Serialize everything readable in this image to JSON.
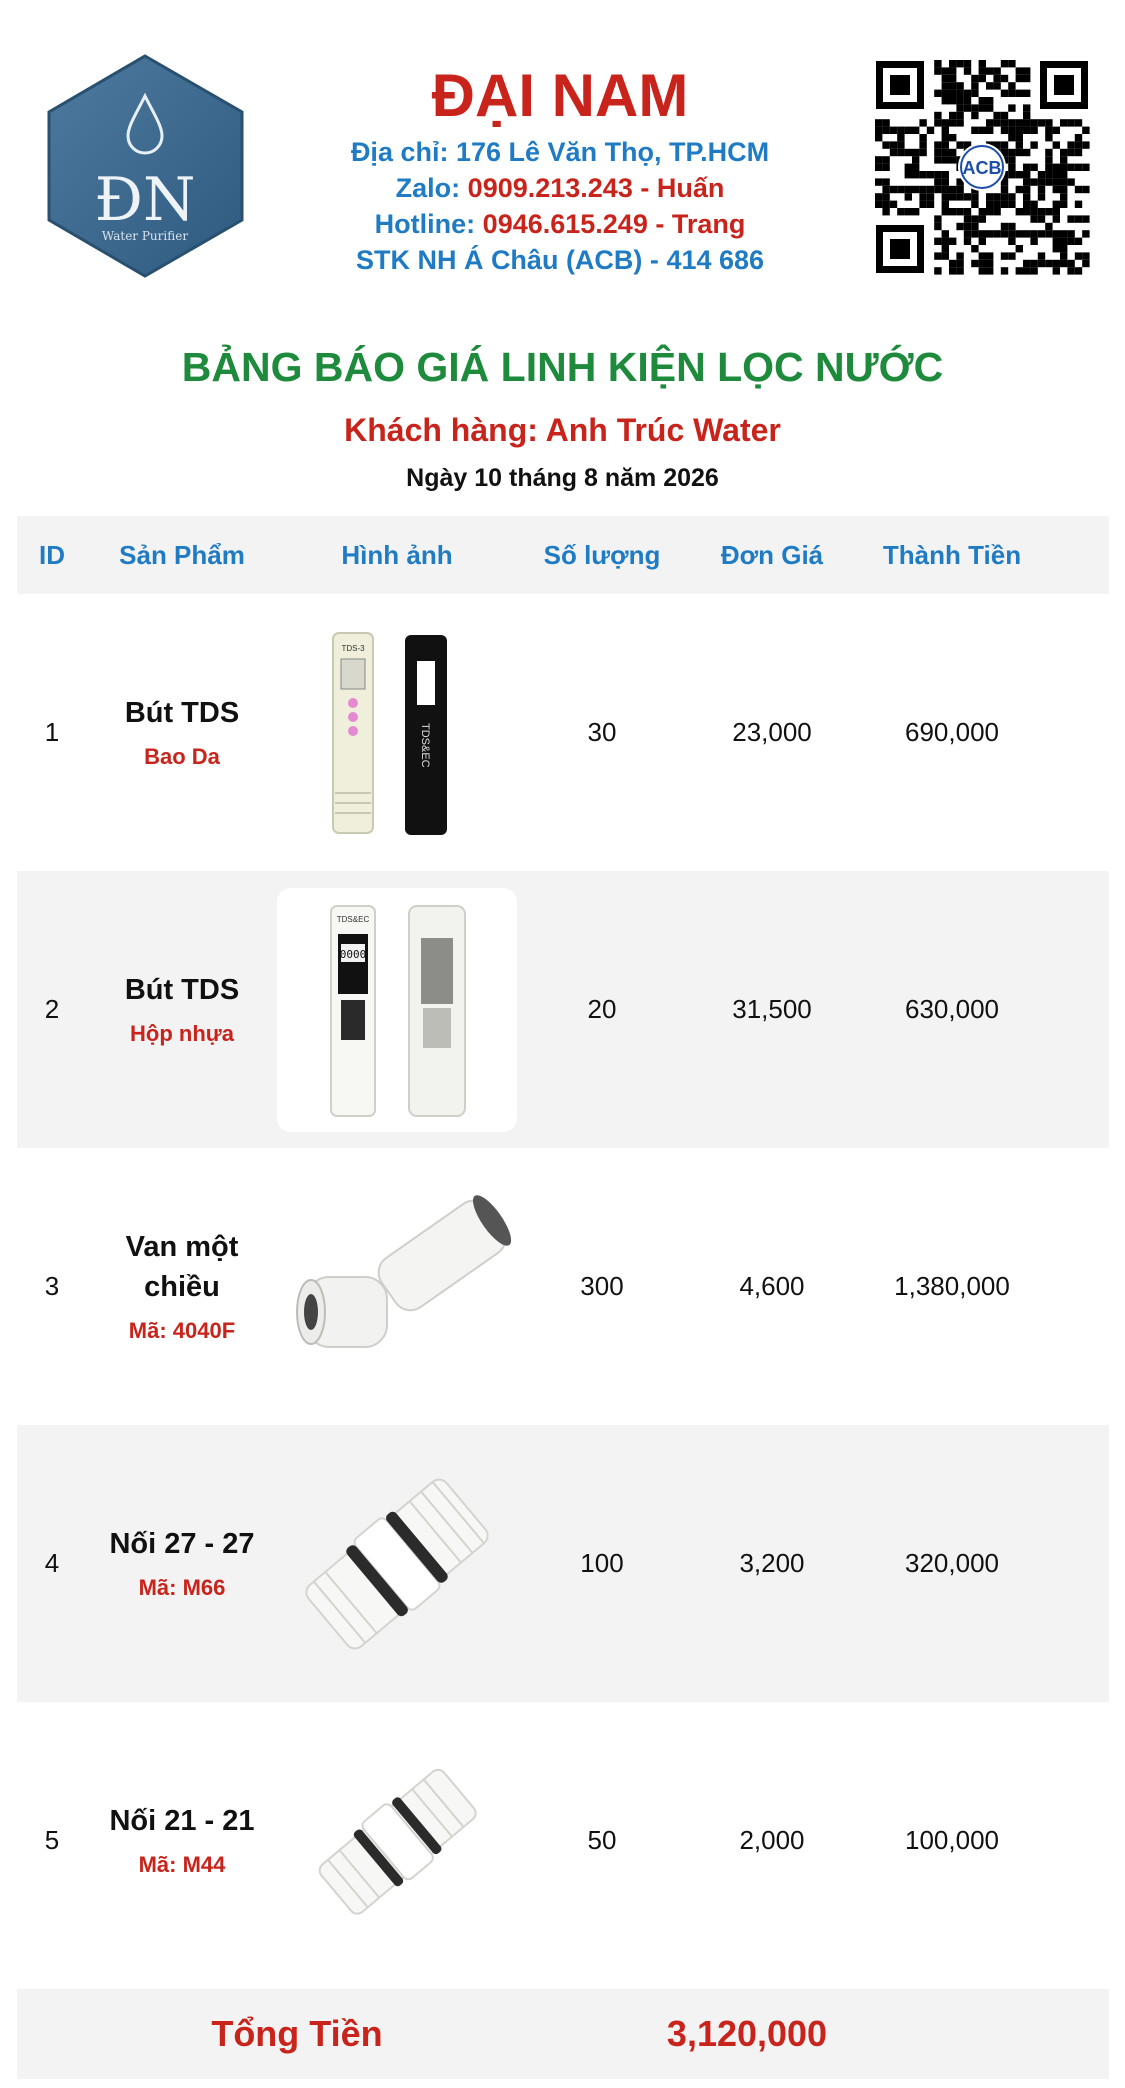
{
  "header": {
    "brand": "ĐẠI NAM",
    "logo_text": "ĐN",
    "logo_tagline": "Water Purifier",
    "address_label": "Địa chỉ:",
    "address_value": "176 Lê Văn Thọ, TP.HCM",
    "zalo_label": "Zalo:",
    "zalo_value": "0909.213.243 - Huấn",
    "hotline_label": "Hotline:",
    "hotline_value": "0946.615.249 - Trang",
    "bank_label": "STK NH Á Châu (ACB) -",
    "bank_value": "414 686",
    "qr_badge": "ACB"
  },
  "title": {
    "main": "BẢNG BÁO GIÁ LINH KIỆN LỌC NƯỚC",
    "customer": "Khách hàng: Anh Trúc Water",
    "date": "Ngày 10 tháng 8 năm 2026"
  },
  "table": {
    "columns": [
      "ID",
      "Sản Phẩm",
      "Hình ảnh",
      "Số lượng",
      "Đơn Giá",
      "Thành Tiền"
    ],
    "rows": [
      {
        "id": "1",
        "name": "Bút TDS",
        "sub": "Bao Da",
        "qty": "30",
        "price": "23,000",
        "total": "690,000"
      },
      {
        "id": "2",
        "name": "Bút TDS",
        "sub": "Hộp nhựa",
        "qty": "20",
        "price": "31,500",
        "total": "630,000"
      },
      {
        "id": "3",
        "name": "Van một chiều",
        "sub": "Mã: 4040F",
        "qty": "300",
        "price": "4,600",
        "total": "1,380,000"
      },
      {
        "id": "4",
        "name": "Nối 27 - 27",
        "sub": "Mã: M66",
        "qty": "100",
        "price": "3,200",
        "total": "320,000"
      },
      {
        "id": "5",
        "name": "Nối 21 - 21",
        "sub": "Mã: M44",
        "qty": "50",
        "price": "2,000",
        "total": "100,000"
      }
    ]
  },
  "footer": {
    "label": "Tổng Tiền",
    "value": "3,120,000"
  },
  "product_images": {
    "row1": {
      "pen_label": "TDS-3",
      "case_label": "TDS&EC"
    },
    "row2": {
      "pen_label": "TDS&EC",
      "display": "0000"
    }
  },
  "colors": {
    "brand_red": "#c8241c",
    "accent_blue": "#1f7bc4",
    "title_green": "#1d8a3c",
    "logo_blue": "#3f6a8f"
  }
}
